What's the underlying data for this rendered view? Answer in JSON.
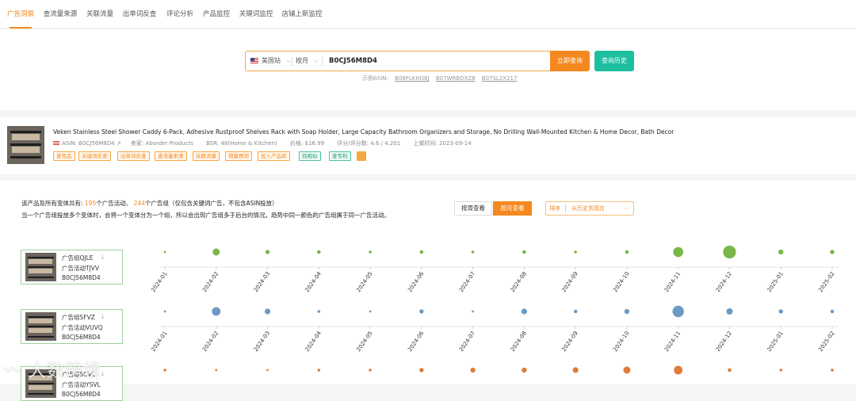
{
  "tabs": [
    {
      "label": "广告洞察",
      "active": true
    },
    {
      "label": "查流量来源",
      "active": false
    },
    {
      "label": "关联流量",
      "active": false
    },
    {
      "label": "出单词反查",
      "active": false
    },
    {
      "label": "评论分析",
      "active": false
    },
    {
      "label": "产品监控",
      "active": false
    },
    {
      "label": "关键词监控",
      "active": false
    },
    {
      "label": "店铺上新监控",
      "active": false
    }
  ],
  "search": {
    "marketplace": "美国站",
    "period": "按月",
    "asin": "B0CJ56M8D4",
    "query_button": "立即查询",
    "history_button": "查询历史",
    "examples_label": "示例ASIN:",
    "examples": [
      "B08FLKHG8J",
      "B07WRBDXZ8",
      "B07SL2X217"
    ]
  },
  "product": {
    "title": "Veken Stainless Steel Shower Caddy 6-Pack, Adhesive Rustproof Shelves Rack with Soap Holder, Large Capacity Bathroom Organizers and Storage, No Drilling Wall-Mounted Kitchen & Home Decor, Bath Decor",
    "asin": "ASIN: B0CJ56M8D4",
    "seller": "卖家: Aborder Products",
    "bsr": "BSR: 48(Home & Kitchen)",
    "price": "价格: $16.99",
    "rating": "评分/评分数: 4.6 / 4,201",
    "launch": "上架时间: 2023-09-14",
    "tags": [
      "查竞品",
      "关键词反查",
      "出单词反查",
      "查流量来源",
      "关联流量",
      "销量预测",
      "加入产品库",
      "找相似",
      "查专利"
    ]
  },
  "summary": {
    "prefix": "该产品及所有变体共有:",
    "campaigns_count": "195",
    "campaigns_label": "个广告活动、",
    "groups_count": "244",
    "groups_label": "个广告组（仅包含关键词广告，不包含ASIN投放）",
    "line2": "当一个广告组投放多个变体时，会将一个变体分为一个组，所以会出现广告组多于后台的情况。趋势中同一颜色的广告组属于同一广告活动。"
  },
  "view": {
    "week": "按周查看",
    "month": "按月查看",
    "sort_label": "排序",
    "sort_value": "从历史到现在"
  },
  "ad_groups": [
    {
      "group": "广告组QJLE",
      "campaign": "广告活动TJVV",
      "asin": "B0CJ56M8D4"
    },
    {
      "group": "广告组SFVZ",
      "campaign": "广告活动VUVQ",
      "asin": "B0CJ56M8D4"
    },
    {
      "group": "广告组SCVL",
      "campaign": "广告活动YSVL",
      "asin": "B0CJ56M8D4"
    }
  ],
  "chart_data": {
    "type": "scatter",
    "x": [
      "2024-01",
      "2024-02",
      "2024-03",
      "2024-04",
      "2024-05",
      "2024-06",
      "2024-07",
      "2024-08",
      "2024-09",
      "2024-10",
      "2024-11",
      "2024-12",
      "2025-01",
      "2025-02"
    ],
    "series": [
      {
        "color": "#7ab648",
        "values": [
          1,
          5,
          3,
          2.5,
          2,
          2.5,
          2,
          2.5,
          2,
          2.5,
          7,
          9,
          3.5,
          3
        ]
      },
      {
        "color": "#6b9bc3",
        "values": [
          0.6,
          6,
          4,
          2,
          0.8,
          3,
          1.2,
          4,
          2.5,
          3.5,
          8,
          4.5,
          3,
          2.5
        ]
      },
      {
        "color": "#e07b3a",
        "values": [
          2,
          1,
          1.5,
          2,
          2,
          3,
          3.5,
          3.5,
          4,
          5,
          6,
          2.5,
          2,
          2
        ]
      }
    ]
  },
  "watermark": "大数跨境"
}
